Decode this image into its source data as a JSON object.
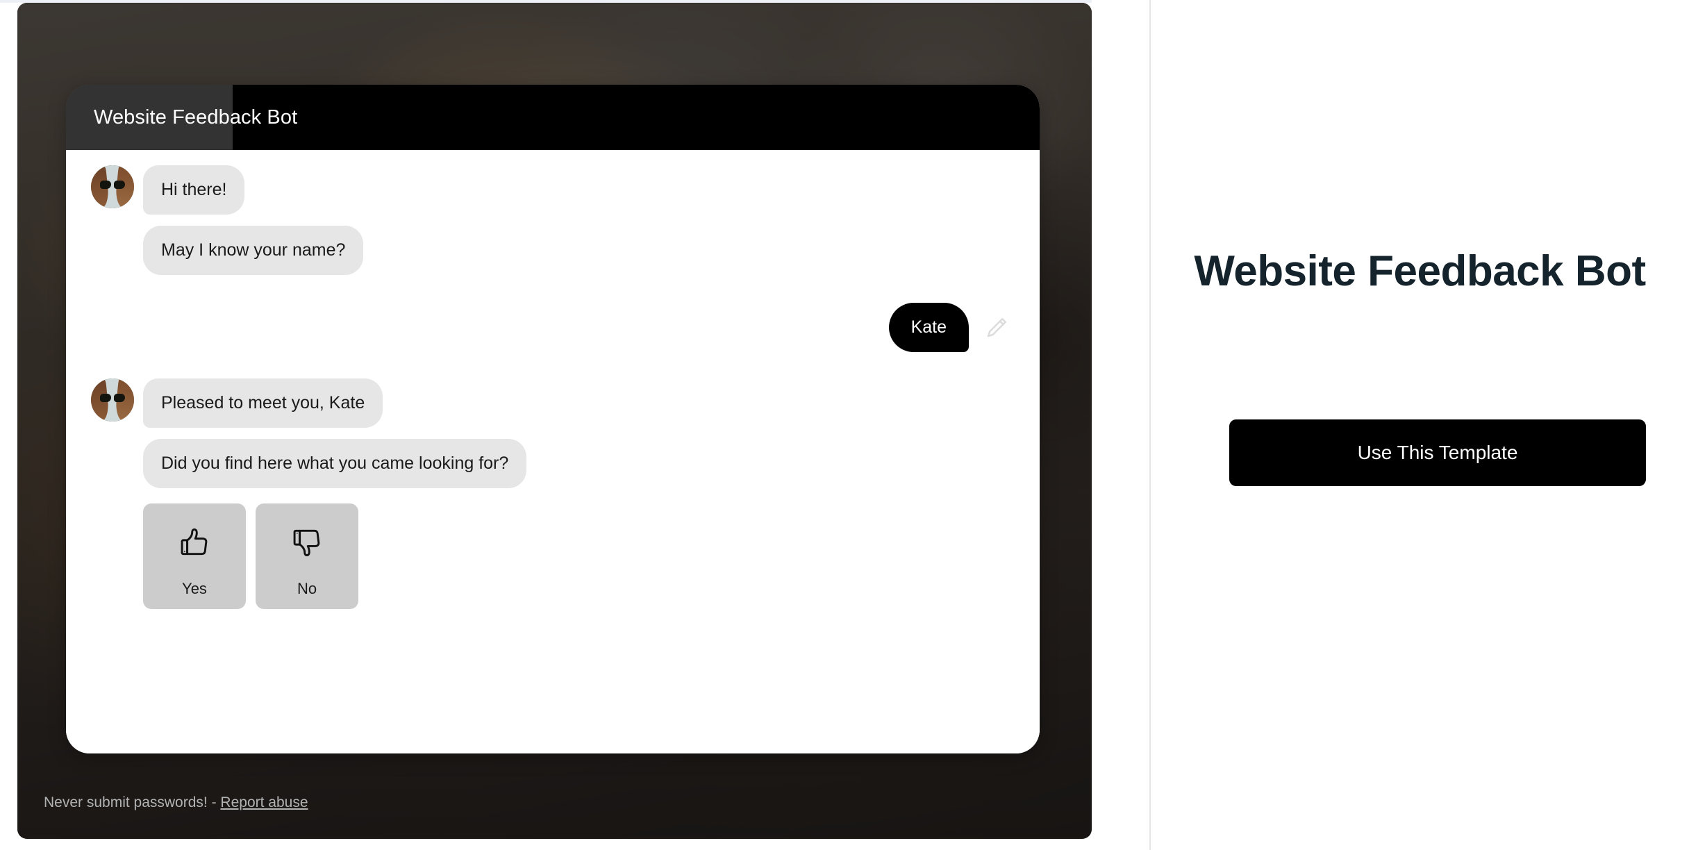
{
  "page": {
    "background_color": "#ffffff",
    "top_strip_color": "#eef0f7"
  },
  "preview": {
    "panel_background_color": "#3d3731",
    "footer": {
      "notice_text": "Never submit passwords! - ",
      "report_link_label": "Report abuse"
    }
  },
  "chat": {
    "header": {
      "title": "Website Feedback Bot",
      "background_color": "#000000",
      "tint_color": "#333333",
      "title_color": "#ffffff"
    },
    "bubble_color": "#e6e6e6",
    "outgoing_bubble_color": "#000000",
    "messages": [
      {
        "id": "msg-1",
        "sender": "bot",
        "text": "Hi there!",
        "has_avatar": true,
        "avatar_name": "bot-avatar-woman-sunglasses"
      },
      {
        "id": "msg-2",
        "sender": "bot",
        "text": "May I know your name?",
        "has_avatar": false
      },
      {
        "id": "msg-3",
        "sender": "user",
        "text": "Kate",
        "edit_icon": "pencil-edit-icon"
      },
      {
        "id": "msg-4",
        "sender": "bot",
        "text": "Pleased to meet you, Kate",
        "has_avatar": true,
        "avatar_name": "bot-avatar-woman-sunglasses"
      },
      {
        "id": "msg-5",
        "sender": "bot",
        "text": "Did you find here what you came looking for?",
        "has_avatar": false
      }
    ],
    "quick_replies": {
      "background_color": "#cccccc",
      "options": [
        {
          "id": "qr-yes",
          "label": "Yes",
          "icon": "thumbs-up-icon"
        },
        {
          "id": "qr-no",
          "label": "No",
          "icon": "thumbs-down-icon"
        }
      ]
    }
  },
  "info": {
    "title": "Website Feedback Bot",
    "title_color": "#14232c",
    "cta_label": "Use This Template",
    "cta_background_color": "#000000",
    "cta_text_color": "#ffffff"
  }
}
